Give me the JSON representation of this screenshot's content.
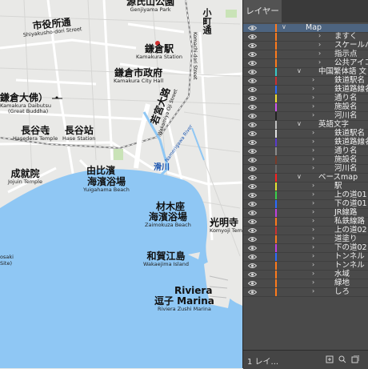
{
  "map": {
    "labels": [
      {
        "id": "genjiyama",
        "jp": "源氏山公園",
        "en": "Genjiyama Park"
      },
      {
        "id": "shiyakusho",
        "jp": "市役所通",
        "en": "Shiyakusho-dori Street"
      },
      {
        "id": "kamakura-station",
        "jp": "鎌倉駅",
        "en": "Kamakura Station"
      },
      {
        "id": "city-hall",
        "jp": "鎌倉市政府",
        "en": "Kamakura City Hall"
      },
      {
        "id": "daibutsu",
        "jp": "鎌倉大佛）",
        "en": "Kamakura Daibutsu"
      },
      {
        "id": "daibutsu2",
        "jp": "",
        "en": "(Great Buddha)"
      },
      {
        "id": "hasedera",
        "jp": "長谷寺",
        "en": "Hasedera Temple"
      },
      {
        "id": "hase-station",
        "jp": "長谷站",
        "en": "Hase Station"
      },
      {
        "id": "jojuin",
        "jp": "成就院",
        "en": "Jojuin Temple"
      },
      {
        "id": "yuigahama",
        "jp": "由比濱",
        "en": ""
      },
      {
        "id": "yuigahama2",
        "jp": "海濱浴場",
        "en": "Yuigahama Beach"
      },
      {
        "id": "zaimokuza",
        "jp": "材木座",
        "en": ""
      },
      {
        "id": "zaimokuza2",
        "jp": "海濱浴場",
        "en": "Zaimokuza Beach"
      },
      {
        "id": "komyoji",
        "jp": "光明寺",
        "en": "Komyoji Temple"
      },
      {
        "id": "wakaejima",
        "jp": "和賀江島",
        "en": "Wakaejima Island"
      },
      {
        "id": "riviera",
        "jp": "Riviera",
        "en": ""
      },
      {
        "id": "riviera2",
        "jp": "逗子 Marina",
        "en": "Riviera Zushi Marina"
      },
      {
        "id": "kosaki",
        "jp": "",
        "en": "osaki"
      },
      {
        "id": "site",
        "jp": "",
        "en": "Site)"
      }
    ],
    "roads": {
      "komachi": "小町通",
      "komachi_en": "Komachi-dori Street",
      "wakamiya": "若宮大路",
      "wakamiya_en": "Wakamiya Oji Street",
      "namerigawa": "滑川",
      "namerigawa_en": "Namerigawa River"
    }
  },
  "panel": {
    "tab_label": "レイヤー",
    "layer_count": "1 レイ...",
    "rows": [
      {
        "name": "Map",
        "color": "#ff7b1c",
        "caret": "∨",
        "indent": 0,
        "selected": true
      },
      {
        "name": "ますく",
        "color": "#ff7b1c",
        "caret": "›",
        "indent": 2
      },
      {
        "name": "スケールバー",
        "color": "#ff7b1c",
        "caret": "›",
        "indent": 2
      },
      {
        "name": "指示点",
        "color": "#ff7b1c",
        "caret": "›",
        "indent": 2
      },
      {
        "name": "公共アイコン",
        "color": "#ff7b1c",
        "caret": "›",
        "indent": 2
      },
      {
        "name": "中国繁体語 文",
        "color": "#3ac7c7",
        "caret": "∨",
        "indent": 1
      },
      {
        "name": "鉄道駅名",
        "color": "#cd3030",
        "caret": "›",
        "indent": 3
      },
      {
        "name": "鉄道路線名",
        "color": "#2a6cff",
        "caret": "›",
        "indent": 3
      },
      {
        "name": "通り名",
        "color": "#f0e030",
        "caret": "›",
        "indent": 3
      },
      {
        "name": "施設名",
        "color": "#cc55ee",
        "caret": "›",
        "indent": 3
      },
      {
        "name": "河川名",
        "color": "#222222",
        "caret": "›",
        "indent": 3
      },
      {
        "name": "英語文字",
        "color": "#c0c0c0",
        "caret": "∨",
        "indent": 1
      },
      {
        "name": "鉄道駅名",
        "color": "#e0e0e0",
        "caret": "›",
        "indent": 3
      },
      {
        "name": "鉄道路線名",
        "color": "#5a3acc",
        "caret": "›",
        "indent": 3
      },
      {
        "name": "通り名",
        "color": "#8a8a8a",
        "caret": "›",
        "indent": 3
      },
      {
        "name": "施設名",
        "color": "#7a3a2a",
        "caret": "›",
        "indent": 3
      },
      {
        "name": "河川名",
        "color": "#6a6a6a",
        "caret": "›",
        "indent": 3
      },
      {
        "name": "ベースmap",
        "color": "#ff2020",
        "caret": "∨",
        "indent": 1
      },
      {
        "name": "駅",
        "color": "#e3e330",
        "caret": "›",
        "indent": 3
      },
      {
        "name": "上の道01",
        "color": "#3ad04a",
        "caret": "›",
        "indent": 3
      },
      {
        "name": "下の道01",
        "color": "#2a6cff",
        "caret": "›",
        "indent": 3
      },
      {
        "name": "JR線路",
        "color": "#c040e0",
        "caret": "›",
        "indent": 3
      },
      {
        "name": "私鉄線路",
        "color": "#ff7b1c",
        "caret": "›",
        "indent": 3
      },
      {
        "name": "上の道02",
        "color": "#cd3030",
        "caret": "›",
        "indent": 3
      },
      {
        "name": "道塗り",
        "color": "#ff7b1c",
        "caret": "›",
        "indent": 3
      },
      {
        "name": "下の道02",
        "color": "#c040e0",
        "caret": "›",
        "indent": 3
      },
      {
        "name": "トンネル",
        "color": "#2a6cff",
        "caret": "›",
        "indent": 3
      },
      {
        "name": "トンネル",
        "color": "#ff7b1c",
        "caret": "›",
        "indent": 3
      },
      {
        "name": "水域",
        "color": "#ff7b1c",
        "caret": "›",
        "indent": 3
      },
      {
        "name": "緑地",
        "color": "#ff7b1c",
        "caret": "›",
        "indent": 3
      },
      {
        "name": "しろ",
        "color": "#ff7b1c",
        "caret": "›",
        "indent": 3
      }
    ]
  },
  "colors": {
    "land": "#e9e9e7",
    "water": "#8fc7f4",
    "road": "#ffffff",
    "station_marker": "#d23030",
    "panel_bg": "#4a4a4a",
    "selected_row": "#4d6480"
  }
}
